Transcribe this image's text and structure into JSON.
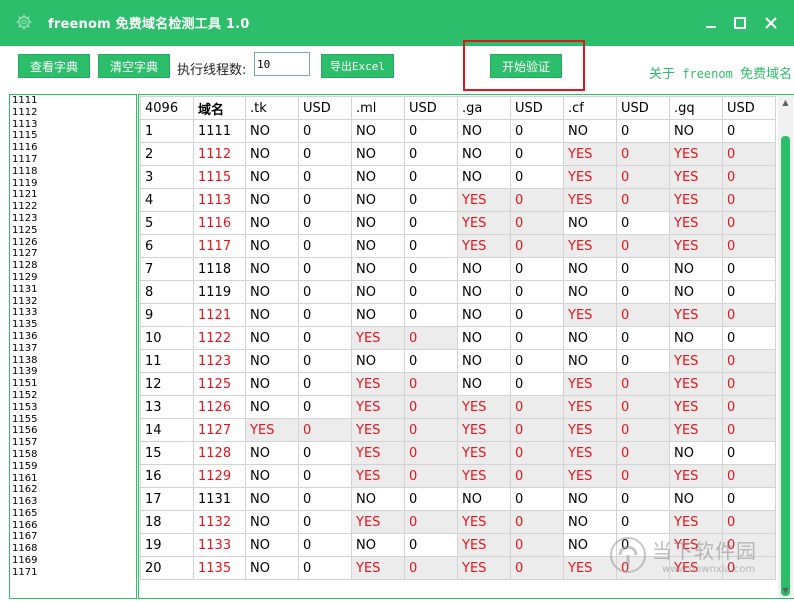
{
  "window": {
    "title": "freenom 免费域名检测工具 1.0",
    "minimize": "—",
    "maximize": "☐",
    "close": "✕"
  },
  "toolbar": {
    "view_dict": "查看字典",
    "clear_dict": "清空字典",
    "threads_label": "执行线程数:",
    "threads_value": "10",
    "export": "导出Excel",
    "start": "开始验证",
    "about_prefix": "关于",
    "about_name": "freenom",
    "about_suffix": "免费域名"
  },
  "wordlist": [
    "1111",
    "1112",
    "1113",
    "1115",
    "1116",
    "1117",
    "1118",
    "1119",
    "1121",
    "1122",
    "1123",
    "1125",
    "1126",
    "1127",
    "1128",
    "1129",
    "1131",
    "1132",
    "1133",
    "1135",
    "1136",
    "1137",
    "1138",
    "1139",
    "1151",
    "1152",
    "1153",
    "1155",
    "1156",
    "1157",
    "1158",
    "1159",
    "1161",
    "1162",
    "1163",
    "1165",
    "1166",
    "1167",
    "1168",
    "1169",
    "1171"
  ],
  "table": {
    "count": "4096",
    "domain_header": "域名",
    "headers": [
      ".tk",
      "USD",
      ".ml",
      "USD",
      ".ga",
      "USD",
      ".cf",
      "USD",
      ".gq",
      "USD"
    ],
    "rows": [
      {
        "n": "1",
        "name": "1111",
        "hit": false,
        "vals": [
          "NO",
          "0",
          "NO",
          "0",
          "NO",
          "0",
          "NO",
          "0",
          "NO",
          "0"
        ]
      },
      {
        "n": "2",
        "name": "1112",
        "hit": true,
        "vals": [
          "NO",
          "0",
          "NO",
          "0",
          "NO",
          "0",
          "YES",
          "0",
          "YES",
          "0"
        ]
      },
      {
        "n": "3",
        "name": "1115",
        "hit": true,
        "vals": [
          "NO",
          "0",
          "NO",
          "0",
          "NO",
          "0",
          "YES",
          "0",
          "YES",
          "0"
        ]
      },
      {
        "n": "4",
        "name": "1113",
        "hit": true,
        "vals": [
          "NO",
          "0",
          "NO",
          "0",
          "YES",
          "0",
          "YES",
          "0",
          "YES",
          "0"
        ]
      },
      {
        "n": "5",
        "name": "1116",
        "hit": true,
        "vals": [
          "NO",
          "0",
          "NO",
          "0",
          "YES",
          "0",
          "NO",
          "0",
          "YES",
          "0"
        ]
      },
      {
        "n": "6",
        "name": "1117",
        "hit": true,
        "vals": [
          "NO",
          "0",
          "NO",
          "0",
          "YES",
          "0",
          "YES",
          "0",
          "YES",
          "0"
        ]
      },
      {
        "n": "7",
        "name": "1118",
        "hit": false,
        "vals": [
          "NO",
          "0",
          "NO",
          "0",
          "NO",
          "0",
          "NO",
          "0",
          "NO",
          "0"
        ]
      },
      {
        "n": "8",
        "name": "1119",
        "hit": false,
        "vals": [
          "NO",
          "0",
          "NO",
          "0",
          "NO",
          "0",
          "NO",
          "0",
          "NO",
          "0"
        ]
      },
      {
        "n": "9",
        "name": "1121",
        "hit": true,
        "vals": [
          "NO",
          "0",
          "NO",
          "0",
          "NO",
          "0",
          "YES",
          "0",
          "YES",
          "0"
        ]
      },
      {
        "n": "10",
        "name": "1122",
        "hit": true,
        "vals": [
          "NO",
          "0",
          "YES",
          "0",
          "NO",
          "0",
          "NO",
          "0",
          "NO",
          "0"
        ]
      },
      {
        "n": "11",
        "name": "1123",
        "hit": true,
        "vals": [
          "NO",
          "0",
          "NO",
          "0",
          "NO",
          "0",
          "NO",
          "0",
          "YES",
          "0"
        ]
      },
      {
        "n": "12",
        "name": "1125",
        "hit": true,
        "vals": [
          "NO",
          "0",
          "YES",
          "0",
          "NO",
          "0",
          "YES",
          "0",
          "YES",
          "0"
        ]
      },
      {
        "n": "13",
        "name": "1126",
        "hit": true,
        "vals": [
          "NO",
          "0",
          "YES",
          "0",
          "YES",
          "0",
          "YES",
          "0",
          "YES",
          "0"
        ]
      },
      {
        "n": "14",
        "name": "1127",
        "hit": true,
        "vals": [
          "YES",
          "0",
          "YES",
          "0",
          "YES",
          "0",
          "YES",
          "0",
          "YES",
          "0"
        ]
      },
      {
        "n": "15",
        "name": "1128",
        "hit": true,
        "vals": [
          "NO",
          "0",
          "YES",
          "0",
          "YES",
          "0",
          "YES",
          "0",
          "NO",
          "0"
        ]
      },
      {
        "n": "16",
        "name": "1129",
        "hit": true,
        "vals": [
          "NO",
          "0",
          "YES",
          "0",
          "YES",
          "0",
          "YES",
          "0",
          "YES",
          "0"
        ]
      },
      {
        "n": "17",
        "name": "1131",
        "hit": false,
        "vals": [
          "NO",
          "0",
          "NO",
          "0",
          "NO",
          "0",
          "NO",
          "0",
          "NO",
          "0"
        ]
      },
      {
        "n": "18",
        "name": "1132",
        "hit": true,
        "vals": [
          "NO",
          "0",
          "YES",
          "0",
          "YES",
          "0",
          "NO",
          "0",
          "YES",
          "0"
        ]
      },
      {
        "n": "19",
        "name": "1133",
        "hit": true,
        "vals": [
          "NO",
          "0",
          "NO",
          "0",
          "YES",
          "0",
          "NO",
          "0",
          "YES",
          "0"
        ]
      },
      {
        "n": "20",
        "name": "1135",
        "hit": true,
        "vals": [
          "NO",
          "0",
          "YES",
          "0",
          "YES",
          "0",
          "YES",
          "0",
          "YES",
          "0"
        ]
      }
    ]
  },
  "watermark": {
    "cn": "当下软件园",
    "url": "www.downxia.com"
  },
  "colors": {
    "accent": "#2dbe6b",
    "yes": "#e5141c",
    "highlight_frame": "#e5141c"
  }
}
